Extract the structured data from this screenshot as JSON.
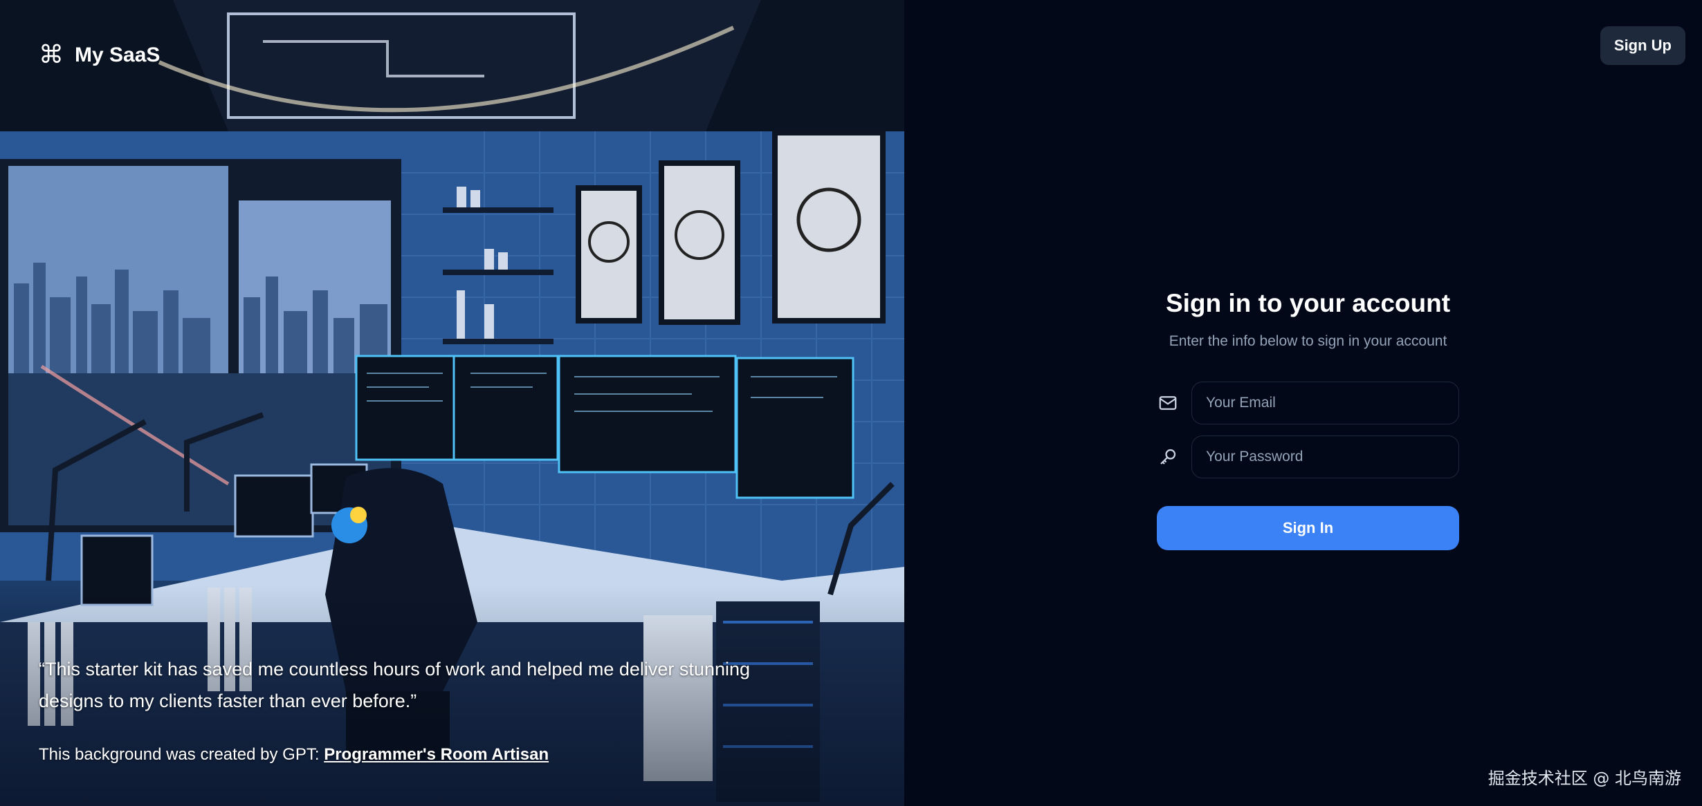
{
  "brand": {
    "icon": "command-icon",
    "name": "My SaaS"
  },
  "testimonial": {
    "quote": "“This starter kit has saved me countless hours of work and helped me deliver stunning designs to my clients faster than ever before.”"
  },
  "credit": {
    "prefix": "This background was created by GPT: ",
    "link_text": "Programmer's Room Artisan"
  },
  "header": {
    "signup_label": "Sign Up"
  },
  "form": {
    "title": "Sign in to your account",
    "subtitle": "Enter the info below to sign in your account",
    "email_placeholder": "Your Email",
    "email_icon": "mail-icon",
    "password_placeholder": "Your Password",
    "password_icon": "key-icon",
    "submit_label": "Sign In"
  },
  "watermark": "掘金技术社区 @ 北鸟南游",
  "colors": {
    "background": "#020817",
    "primary": "#3b82f6",
    "muted": "#94a3b8",
    "secondary": "#1e293b"
  }
}
